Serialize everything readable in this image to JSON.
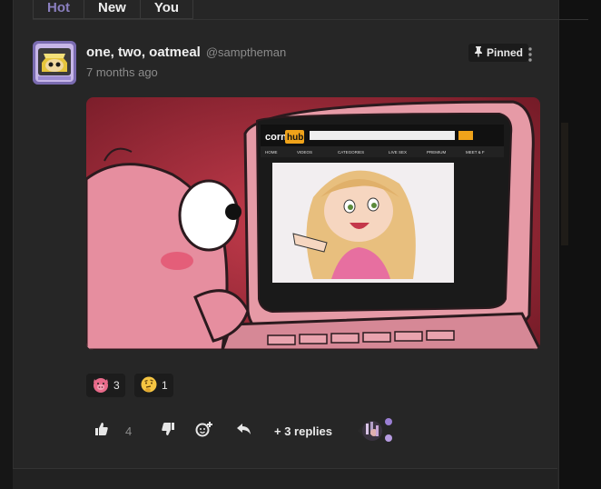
{
  "tabs": [
    {
      "label": "Hot",
      "active": true
    },
    {
      "label": "New",
      "active": false
    },
    {
      "label": "You",
      "active": false
    }
  ],
  "post": {
    "author_name": "one, two, oatmeal",
    "author_handle": "@samptheman",
    "timestamp": "7 months ago",
    "pinned_label": "Pinned",
    "image": {
      "description": "cartoon of pink creature looking at computer",
      "screen_logo_left": "corn",
      "screen_logo_right": "hub",
      "screen_nav": [
        "HOME",
        "VIDEOS",
        "CATEGORIES",
        "LIVE SEX",
        "PREMIUM",
        "MEET & F"
      ]
    }
  },
  "reactions": [
    {
      "icon": "pig-face-icon",
      "count": "3"
    },
    {
      "icon": "thinking-face-icon",
      "count": "1"
    }
  ],
  "actions": {
    "like_icon": "thumbs-up-icon",
    "like_count": "4",
    "dislike_icon": "thumbs-down-icon",
    "react_icon": "add-reaction-icon",
    "reply_icon": "reply-arrow-icon",
    "replies_label": "+ 3 replies"
  },
  "colors": {
    "accent_tab": "#8a7fbf",
    "panel_bg": "#262626",
    "chip_bg": "#1c1c1c"
  }
}
